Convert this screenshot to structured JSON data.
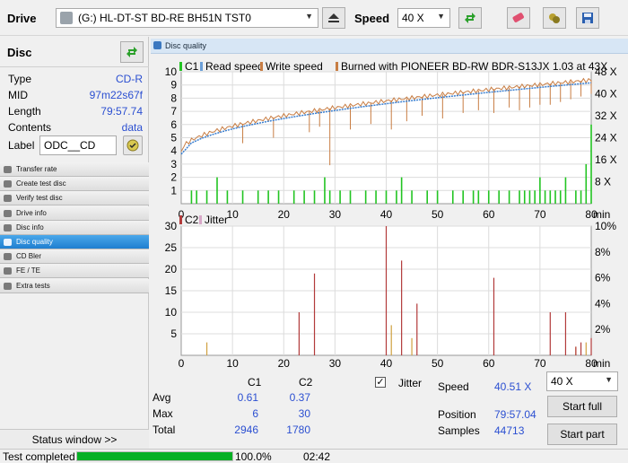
{
  "toolbar": {
    "drive_label": "Drive",
    "drive_value": "(G:)  HL-DT-ST BD-RE  BH51N TST0",
    "speed_label": "Speed",
    "speed_value": "40 X",
    "icons": [
      "eject-icon",
      "refresh-icon",
      "eraser-icon",
      "save-image-icon",
      "save-icon"
    ]
  },
  "disc": {
    "header": "Disc",
    "fields": [
      {
        "key": "Type",
        "value": "CD-R"
      },
      {
        "key": "MID",
        "value": "97m22s67f"
      },
      {
        "key": "Length",
        "value": "79:57.74"
      },
      {
        "key": "Contents",
        "value": "data"
      }
    ],
    "label_key": "Label",
    "label_value": "ODC__CD"
  },
  "nav": [
    {
      "label": "Transfer rate",
      "active": false
    },
    {
      "label": "Create test disc",
      "active": false
    },
    {
      "label": "Verify test disc",
      "active": false
    },
    {
      "label": "Drive info",
      "active": false
    },
    {
      "label": "Disc info",
      "active": false
    },
    {
      "label": "Disc quality",
      "active": true
    },
    {
      "label": "CD Bler",
      "active": false
    },
    {
      "label": "FE / TE",
      "active": false
    },
    {
      "label": "Extra tests",
      "active": false
    }
  ],
  "status_window_label": "Status window >>",
  "panel_title": "Disc quality",
  "chart_data": [
    {
      "type": "bar",
      "legend": [
        "C1",
        "Read speed",
        "Write speed",
        "Burned with PIONEER BD-RW  BDR-S13JX 1.03 at 43X"
      ],
      "x_ticks": [
        "0",
        "10",
        "20",
        "30",
        "40",
        "50",
        "60",
        "70",
        "80"
      ],
      "x_unit": "min",
      "xlim": [
        0,
        80
      ],
      "y_ticks": [
        "1",
        "2",
        "3",
        "4",
        "5",
        "6",
        "7",
        "8",
        "9",
        "10"
      ],
      "ylim": [
        0,
        10
      ],
      "y2_ticks": [
        "8 X",
        "16 X",
        "24 X",
        "32 X",
        "40 X",
        "48 X"
      ],
      "y2lim": [
        0,
        48
      ],
      "colors": {
        "c1": "#22c422",
        "read": "#3a7fd0",
        "write": "#c87d43",
        "legend_c1": "#22c422",
        "legend_read": "#6b9fd8",
        "legend_write": "#c87d43",
        "legend_burn": "#c87d43"
      },
      "speed_start": 19,
      "speed_end": 45,
      "c1_bars": [
        [
          2,
          1
        ],
        [
          3,
          1
        ],
        [
          5,
          1
        ],
        [
          7,
          2
        ],
        [
          9,
          1
        ],
        [
          12,
          1
        ],
        [
          15,
          1
        ],
        [
          17,
          1
        ],
        [
          19,
          1
        ],
        [
          22,
          1
        ],
        [
          24,
          1
        ],
        [
          26,
          1
        ],
        [
          28,
          2
        ],
        [
          29,
          1
        ],
        [
          31,
          1
        ],
        [
          33,
          1
        ],
        [
          36,
          1
        ],
        [
          38,
          1
        ],
        [
          40,
          1
        ],
        [
          42,
          1
        ],
        [
          43,
          2
        ],
        [
          45,
          1
        ],
        [
          48,
          1
        ],
        [
          50,
          1
        ],
        [
          53,
          1
        ],
        [
          55,
          1
        ],
        [
          57,
          1
        ],
        [
          58,
          1
        ],
        [
          60,
          1
        ],
        [
          62,
          1
        ],
        [
          64,
          1
        ],
        [
          66,
          1
        ],
        [
          67,
          1
        ],
        [
          68,
          1
        ],
        [
          69,
          1
        ],
        [
          70,
          2
        ],
        [
          71,
          1
        ],
        [
          72,
          1
        ],
        [
          73,
          1
        ],
        [
          74,
          1
        ],
        [
          75,
          2
        ],
        [
          77,
          1
        ],
        [
          78,
          1
        ],
        [
          79,
          3
        ],
        [
          80,
          6
        ]
      ],
      "write_dips": [
        [
          12,
          22
        ],
        [
          18,
          24
        ],
        [
          25,
          26
        ],
        [
          27,
          28
        ],
        [
          29,
          14
        ],
        [
          33,
          27
        ],
        [
          37,
          29
        ],
        [
          41,
          27
        ],
        [
          44,
          30
        ],
        [
          47,
          32
        ],
        [
          51,
          31
        ],
        [
          55,
          33
        ],
        [
          58,
          34
        ],
        [
          61,
          33
        ],
        [
          64,
          35
        ],
        [
          66,
          34
        ],
        [
          68,
          35
        ],
        [
          70,
          36
        ],
        [
          72,
          36
        ],
        [
          74,
          37
        ],
        [
          76,
          38
        ],
        [
          78,
          39
        ],
        [
          80,
          40
        ]
      ]
    },
    {
      "type": "bar",
      "legend": [
        "C2",
        "Jitter"
      ],
      "x_ticks": [
        "0",
        "10",
        "20",
        "30",
        "40",
        "50",
        "60",
        "70",
        "80"
      ],
      "x_unit": "min",
      "xlim": [
        0,
        80
      ],
      "y_ticks": [
        "5",
        "10",
        "15",
        "20",
        "25",
        "30"
      ],
      "ylim": [
        0,
        30
      ],
      "y2_ticks": [
        "2%",
        "4%",
        "6%",
        "8%",
        "10%"
      ],
      "y2lim": [
        0,
        10
      ],
      "colors": {
        "c2": "#b23a3a",
        "jitter": "#d0a040"
      },
      "c2_bars": [
        [
          23,
          10
        ],
        [
          26,
          19
        ],
        [
          40,
          30
        ],
        [
          43,
          22
        ],
        [
          46,
          12
        ],
        [
          61,
          18
        ],
        [
          72,
          10
        ],
        [
          75,
          10
        ],
        [
          77,
          2
        ],
        [
          78,
          3
        ],
        [
          80,
          4
        ]
      ],
      "jitter_bars": [
        [
          5,
          3
        ],
        [
          41,
          7
        ],
        [
          45,
          4
        ],
        [
          77,
          2
        ],
        [
          79,
          3
        ]
      ]
    }
  ],
  "stats": {
    "col_c1": "C1",
    "col_c2": "C2",
    "rows": [
      {
        "label": "Avg",
        "c1": "0.61",
        "c2": "0.37"
      },
      {
        "label": "Max",
        "c1": "6",
        "c2": "30"
      },
      {
        "label": "Total",
        "c1": "2946",
        "c2": "1780"
      }
    ],
    "jitter_label": "Jitter",
    "jitter_checked": true,
    "speed_label": "Speed",
    "speed_value": "40.51 X",
    "position_label": "Position",
    "position_value": "79:57.04",
    "samples_label": "Samples",
    "samples_value": "44713",
    "speed_select": "40 X",
    "start_full": "Start full",
    "start_part": "Start part"
  },
  "status": {
    "text": "Test completed",
    "progress": 100,
    "progress_text": "100.0%",
    "time": "02:42"
  }
}
